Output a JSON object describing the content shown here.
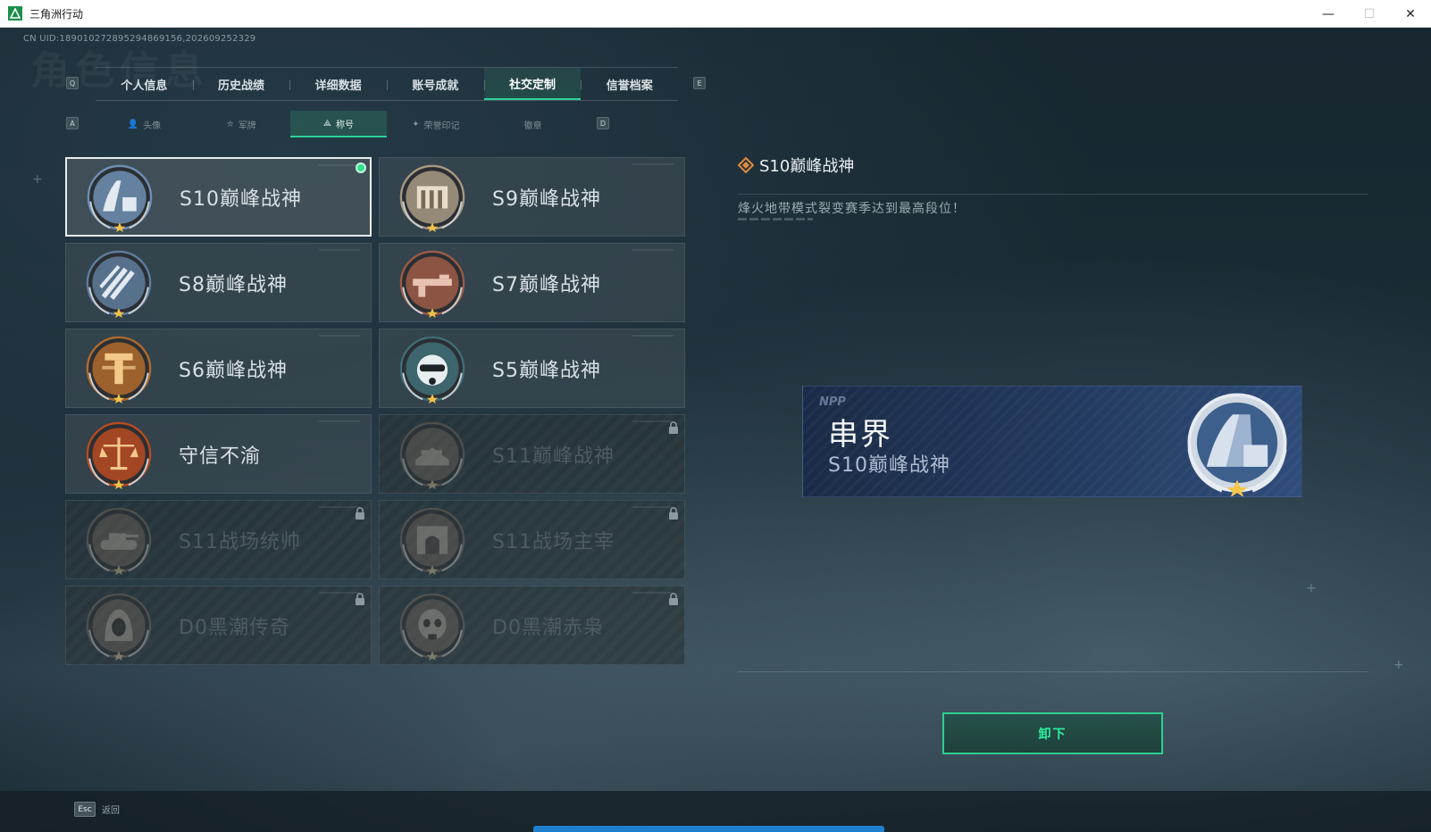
{
  "window": {
    "title": "三角洲行动",
    "minimize": "—",
    "maximize": "☐",
    "close": "✕"
  },
  "uid_text": "CN UID:1890102728952948691​56,202609252329",
  "watermark_text": "角色信息",
  "main_tabs": {
    "left_key": "Q",
    "right_key": "E",
    "items": [
      {
        "label": "个人信息"
      },
      {
        "label": "历史战绩"
      },
      {
        "label": "详细数据"
      },
      {
        "label": "账号成就"
      },
      {
        "label": "社交定制",
        "active": true
      },
      {
        "label": "信誉档案"
      }
    ]
  },
  "sub_tabs": {
    "left_key": "A",
    "right_key": "D",
    "items": [
      {
        "label": "头像",
        "glyph": "👤"
      },
      {
        "label": "军牌",
        "glyph": "⛤"
      },
      {
        "label": "称号",
        "glyph": "⟁",
        "active": true
      },
      {
        "label": "荣誉印记",
        "glyph": "✦"
      },
      {
        "label": "徽章",
        "glyph": ""
      }
    ]
  },
  "titles": [
    {
      "label": "S10巅峰战神",
      "medal": "s10-medal",
      "color": "#6f8fb4",
      "locked": false,
      "equipped": true
    },
    {
      "label": "S9巅峰战神",
      "medal": "s9-medal",
      "color": "#a89a84",
      "locked": false
    },
    {
      "label": "S8巅峰战神",
      "medal": "s8-medal",
      "color": "#5f7d9e",
      "locked": false
    },
    {
      "label": "S7巅峰战神",
      "medal": "s7-medal",
      "color": "#9c5a46",
      "locked": false
    },
    {
      "label": "S6巅峰战神",
      "medal": "s6-medal",
      "color": "#b06a2c",
      "locked": false
    },
    {
      "label": "S5巅峰战神",
      "medal": "s5-medal",
      "color": "#3f6e78",
      "locked": false
    },
    {
      "label": "守信不渝",
      "medal": "scales-medal",
      "color": "#b84a22",
      "locked": false
    },
    {
      "label": "S11巅峰战神",
      "medal": "s11-medal",
      "color": "#8a6a4c",
      "locked": true
    },
    {
      "label": "S11战场统帅",
      "medal": "tank-medal",
      "color": "#8a6a4c",
      "locked": true
    },
    {
      "label": "S11战场主宰",
      "medal": "arch-medal",
      "color": "#8a6a4c",
      "locked": true
    },
    {
      "label": "D0黑潮传奇",
      "medal": "hood-medal",
      "color": "#8a6a4c",
      "locked": true
    },
    {
      "label": "D0黑潮赤枭",
      "medal": "skull-medal",
      "color": "#8a6a4c",
      "locked": true
    }
  ],
  "detail": {
    "title": "S10巅峰战神",
    "description": "烽火地带模式裂变赛季达到最高段位！",
    "nameplate": {
      "logo": "NPP",
      "player_name": "串界",
      "title": "S10巅峰战神"
    },
    "unequip_label": "卸下"
  },
  "bottom": {
    "esc_key": "Esc",
    "back_label": "返回"
  }
}
